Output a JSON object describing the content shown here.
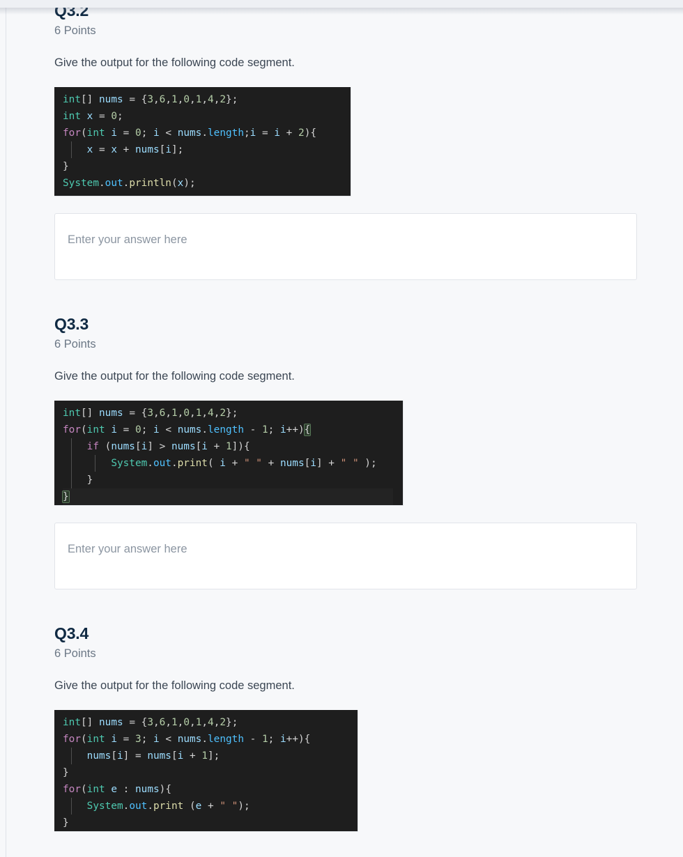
{
  "page": {
    "background_color": "#f7f8fa",
    "topbar_color": "#eef0f4"
  },
  "answer_input": {
    "placeholder": "Enter your answer here",
    "value": ""
  },
  "questions": [
    {
      "id": "q3-2",
      "title": "Q3.2",
      "points": "6 Points",
      "prompt": "Give the output for the following code segment.",
      "code": {
        "language": "java",
        "text": "int[] nums = {3,6,1,0,1,4,2};\nint x = 0;\nfor(int i = 0; i < nums.length;i = i + 2){\n    x = x + nums[i];\n}\nSystem.out.println(x);"
      }
    },
    {
      "id": "q3-3",
      "title": "Q3.3",
      "points": "6 Points",
      "prompt": "Give the output for the following code segment.",
      "code": {
        "language": "java",
        "text": "int[] nums = {3,6,1,0,1,4,2};\nfor(int i = 0; i < nums.length - 1; i++){\n    if (nums[i] > nums[i + 1]){\n        System.out.print( i + \" \" + nums[i] + \" \" );\n    }\n}"
      }
    },
    {
      "id": "q3-4",
      "title": "Q3.4",
      "points": "6 Points",
      "prompt": "Give the output for the following code segment.",
      "code": {
        "language": "java",
        "text": "int[] nums = {3,6,1,0,1,4,2};\nfor(int i = 3; i < nums.length - 1; i++){\n    nums[i] = nums[i + 1];\n}\nfor(int e : nums){\n    System.out.print (e + \" \");\n}"
      }
    }
  ],
  "syntax_colors": {
    "background": "#1e1e1e",
    "default": "#d4d4d4",
    "keyword": "#c586c0",
    "type": "#4ec9b0",
    "number": "#b5cea8",
    "property": "#4fc1ff",
    "function": "#dcdcaa",
    "string": "#ce9178",
    "variable": "#9cdcfe"
  }
}
